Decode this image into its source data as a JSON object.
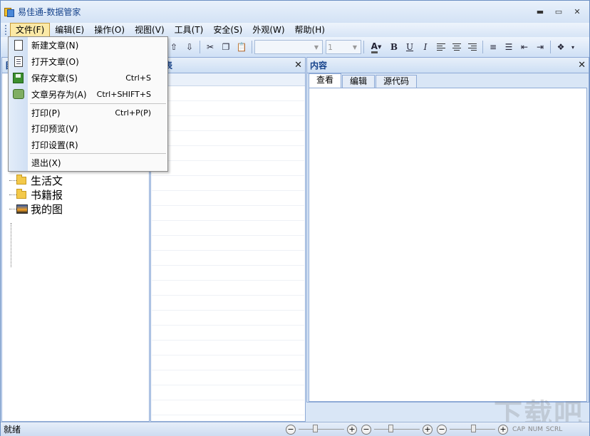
{
  "window": {
    "title": "易佳通-数据管家"
  },
  "menubar": {
    "items": [
      "文件(F)",
      "编辑(E)",
      "操作(O)",
      "视图(V)",
      "工具(T)",
      "安全(S)",
      "外观(W)",
      "帮助(H)"
    ]
  },
  "toolbar": {
    "font_size_value": "1"
  },
  "dropdown": {
    "items": [
      {
        "label": "新建文章(N)",
        "shortcut": ""
      },
      {
        "label": "打开文章(O)",
        "shortcut": ""
      },
      {
        "label": "保存文章(S)",
        "shortcut": "Ctrl+S"
      },
      {
        "label": "文章另存为(A)",
        "shortcut": "Ctrl+SHIFT+S"
      },
      {
        "label": "打印(P)",
        "shortcut": "Ctrl+P(P)"
      },
      {
        "label": "打印预览(V)",
        "shortcut": ""
      },
      {
        "label": "打印设置(R)",
        "shortcut": ""
      },
      {
        "label": "退出(X)",
        "shortcut": ""
      }
    ]
  },
  "left_panel": {
    "header_initial": "目",
    "tree": [
      "生活文",
      "书籍报",
      "我的图"
    ]
  },
  "middle_panel": {
    "header_partial": "表"
  },
  "right_panel": {
    "title": "内容",
    "tabs": [
      "查看",
      "编辑",
      "源代码"
    ]
  },
  "statusbar": {
    "text": "就绪",
    "indicators": [
      "CAP",
      "NUM",
      "SCRL"
    ]
  },
  "watermark": "下载吧"
}
